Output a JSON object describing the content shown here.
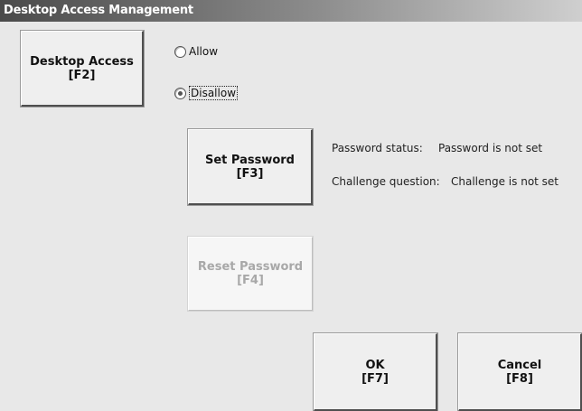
{
  "window": {
    "title": "Desktop Access Management"
  },
  "desktop_access_button": {
    "label": "Desktop Access",
    "key": "[F2]"
  },
  "radio_options": [
    {
      "label": "Allow",
      "checked": false
    },
    {
      "label": "Disallow",
      "checked": true
    }
  ],
  "set_password_button": {
    "label": "Set Password",
    "key": "[F3]"
  },
  "reset_password_button": {
    "label": "Reset Password",
    "key": "[F4]",
    "enabled": false
  },
  "status": {
    "password_label": "Password status:",
    "password_value": "Password is not set",
    "challenge_label": "Challenge question:",
    "challenge_value": "Challenge is not set"
  },
  "ok_button": {
    "label": "OK",
    "key": "[F7]"
  },
  "cancel_button": {
    "label": "Cancel",
    "key": "[F8]"
  }
}
